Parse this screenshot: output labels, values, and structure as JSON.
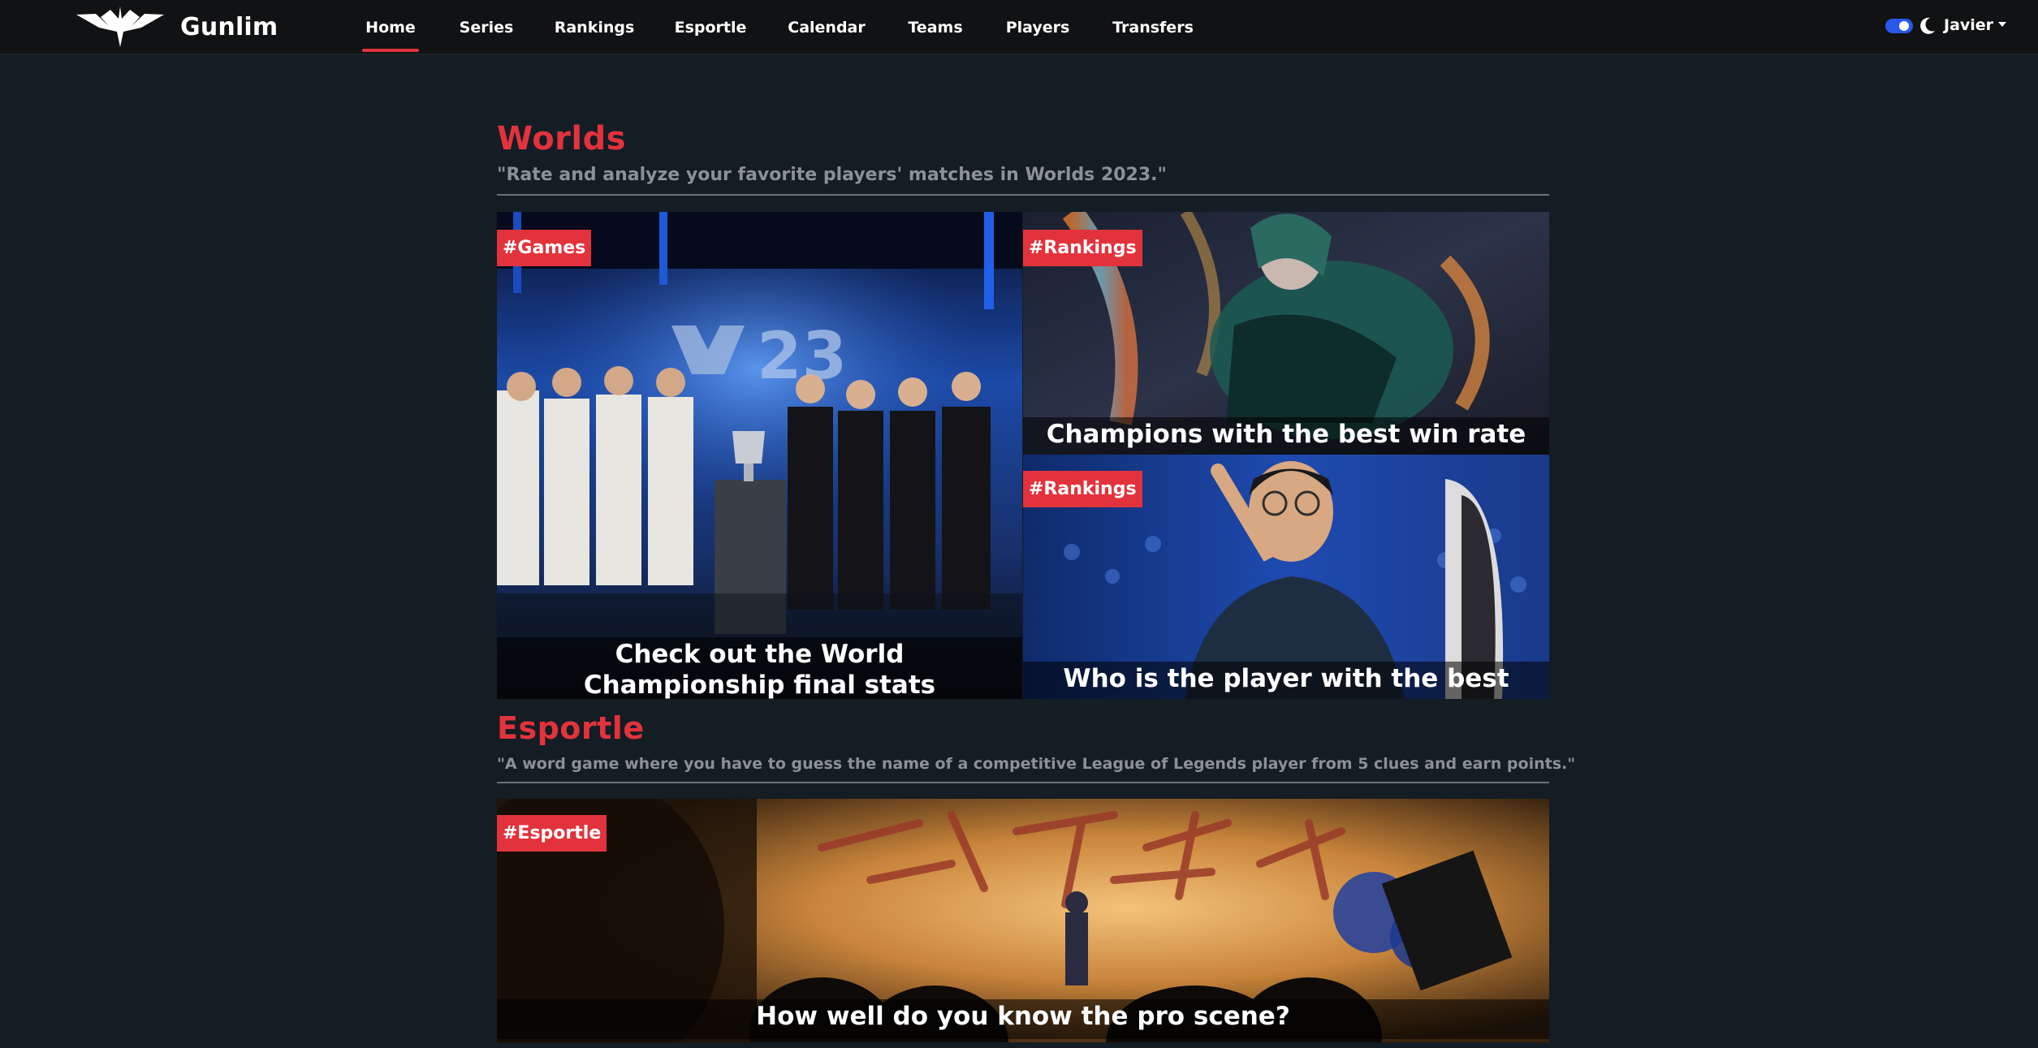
{
  "navbar": {
    "brand_name": "Gunlim",
    "links": [
      {
        "label": "Home"
      },
      {
        "label": "Series"
      },
      {
        "label": "Rankings"
      },
      {
        "label": "Esportle"
      },
      {
        "label": "Calendar"
      },
      {
        "label": "Teams"
      },
      {
        "label": "Players"
      },
      {
        "label": "Transfers"
      }
    ],
    "active_link": "Home",
    "theme_toggle_on": true,
    "user_name": "Javier"
  },
  "sections": {
    "worlds": {
      "title": "Worlds",
      "description": "\"Rate and analyze your favorite players' matches in Worlds 2023.\"",
      "cards": [
        {
          "tag": "#Games",
          "caption": "Check out the World Championship final stats"
        },
        {
          "tag": "#Rankings",
          "caption": "Champions with the best win rate"
        },
        {
          "tag": "#Rankings",
          "caption": "Who is the player with the best KDA?"
        }
      ]
    },
    "esportle": {
      "title": "Esportle",
      "description": "\"A word game where you have to guess the name of a competitive League of Legends player from 5 clues and earn points.\"",
      "cards": [
        {
          "tag": "#Esportle",
          "caption": "How well do you know the pro scene?"
        }
      ]
    }
  },
  "colors": {
    "accent": "#e2333c",
    "page_background": "#141c24",
    "navbar_background": "#101214",
    "muted_text": "#8b9198",
    "toggle": "#2858e8"
  }
}
